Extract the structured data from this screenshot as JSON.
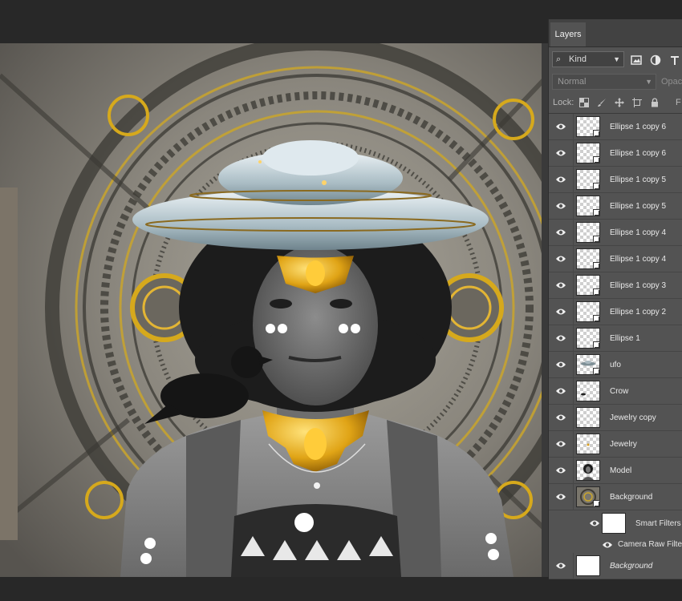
{
  "panel": {
    "tab": "Layers",
    "filter_kind": "Kind",
    "blend_mode": "Normal",
    "opacity_label": "Opaci",
    "lock_label": "Lock:",
    "fill_label": "F"
  },
  "layers": [
    {
      "name": "Ellipse 1 copy 6"
    },
    {
      "name": "Ellipse 1 copy 6"
    },
    {
      "name": "Ellipse 1 copy 5"
    },
    {
      "name": "Ellipse 1 copy 5"
    },
    {
      "name": "Ellipse 1 copy 4"
    },
    {
      "name": "Ellipse 1 copy 4"
    },
    {
      "name": "Ellipse 1 copy 3"
    },
    {
      "name": "Ellipse 1 copy 2"
    },
    {
      "name": "Ellipse 1"
    },
    {
      "name": "ufo"
    },
    {
      "name": "Crow"
    },
    {
      "name": "Jewelry copy"
    },
    {
      "name": "Jewelry"
    },
    {
      "name": "Model"
    },
    {
      "name": "Background"
    }
  ],
  "smart_filters": {
    "label": "Smart Filters",
    "filter": "Camera Raw Filter"
  },
  "base_layer": {
    "name": "Background"
  },
  "icons": [
    "eye-icon",
    "search-icon",
    "image-filter-icon",
    "adjustment-filter-icon",
    "type-filter-icon",
    "lock-pixels-icon",
    "brush-icon",
    "move-icon",
    "artboard-icon",
    "padlock-icon",
    "smart-object-badge-icon"
  ]
}
